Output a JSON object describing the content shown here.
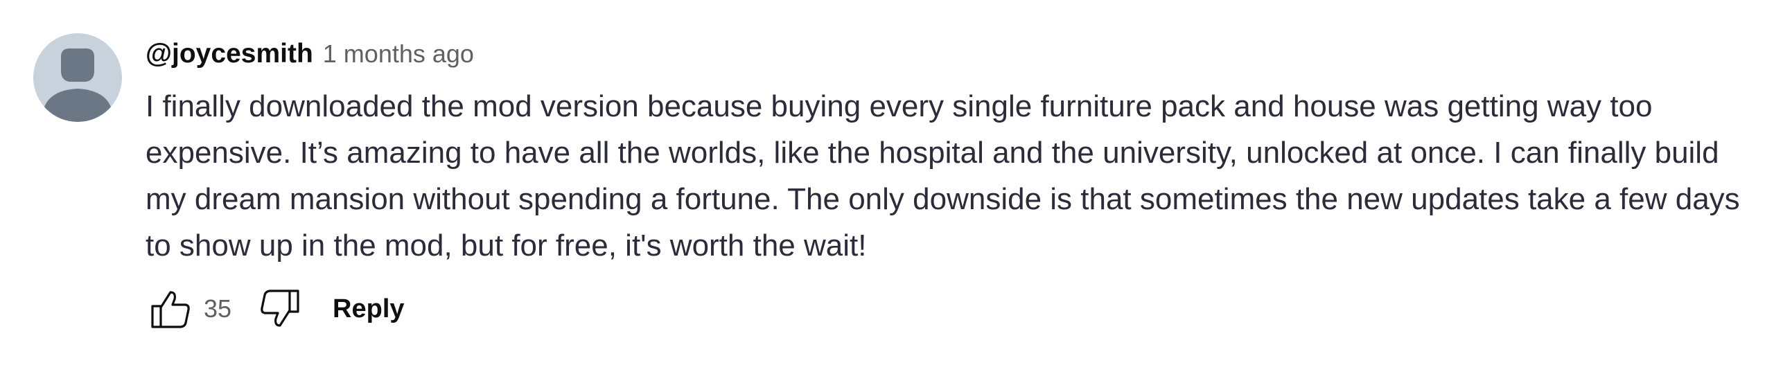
{
  "comment": {
    "author": "@joycesmith",
    "time": "1 months ago",
    "text": "I finally downloaded the mod version because buying every single furniture pack and house was getting way too expensive. It’s amazing to have all the worlds, like the hospital and the university, unlocked at once. I can finally build my dream mansion without spending a fortune. The only downside is that sometimes the new updates take a few days to show up in the mod, but for free, it's worth the wait!",
    "like_count": "35",
    "reply_label": "Reply"
  },
  "icons": {
    "avatar": "default-avatar-icon",
    "like": "thumbs-up-icon",
    "dislike": "thumbs-down-icon"
  },
  "colors": {
    "avatar_bg": "#c8d2dd",
    "avatar_figure": "#6b7785",
    "text": "#2b2b3a",
    "muted": "#606060"
  }
}
